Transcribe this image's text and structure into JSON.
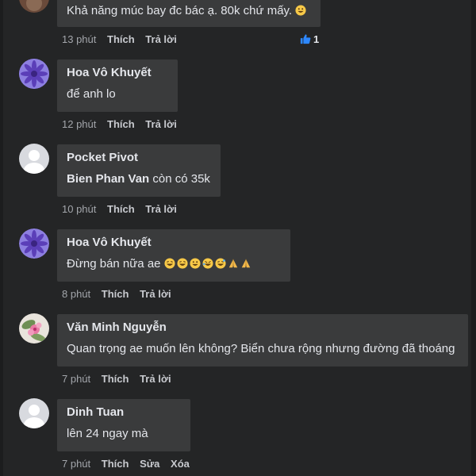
{
  "comments": [
    {
      "text": "Khả năng múc bay đc bác ạ. 80k chứ mấy.",
      "time": "13 phút",
      "like": "Thích",
      "reply": "Trả lời",
      "like_count": "1",
      "emoji": "grinning"
    },
    {
      "author": "Hoa Vô Khuyết",
      "text": "để anh lo",
      "time": "12 phút",
      "like": "Thích",
      "reply": "Trả lời"
    },
    {
      "author": "Pocket Pivot",
      "mention": "Bien Phan Van",
      "text": " còn có 35k",
      "time": "10 phút",
      "like": "Thích",
      "reply": "Trả lời"
    },
    {
      "author": "Hoa Vô Khuyết",
      "text": "Đừng bán nữa ae",
      "emojis": [
        "grinning",
        "grinning",
        "grinning",
        "rofl",
        "grinning-sweat",
        "folded-hands",
        "folded-hands"
      ],
      "time": "8 phút",
      "like": "Thích",
      "reply": "Trả lời"
    },
    {
      "author": "Văn Minh Nguyễn",
      "text": "Quan trọng ae muốn lên không? Biển chưa rộng nhưng đường đã thoáng",
      "time": "7 phút",
      "like": "Thích",
      "reply": "Trả lời"
    },
    {
      "author": "Dinh Tuan",
      "text": "lên 24 ngay mà",
      "time": "7 phút",
      "like": "Thích",
      "edit": "Sửa",
      "delete": "Xóa"
    }
  ],
  "colors": {
    "background": "#242526",
    "bubble": "#3a3b3c",
    "text": "#e4e6eb",
    "meta": "#b0b3b8",
    "like_blue": "#2d88ff"
  }
}
